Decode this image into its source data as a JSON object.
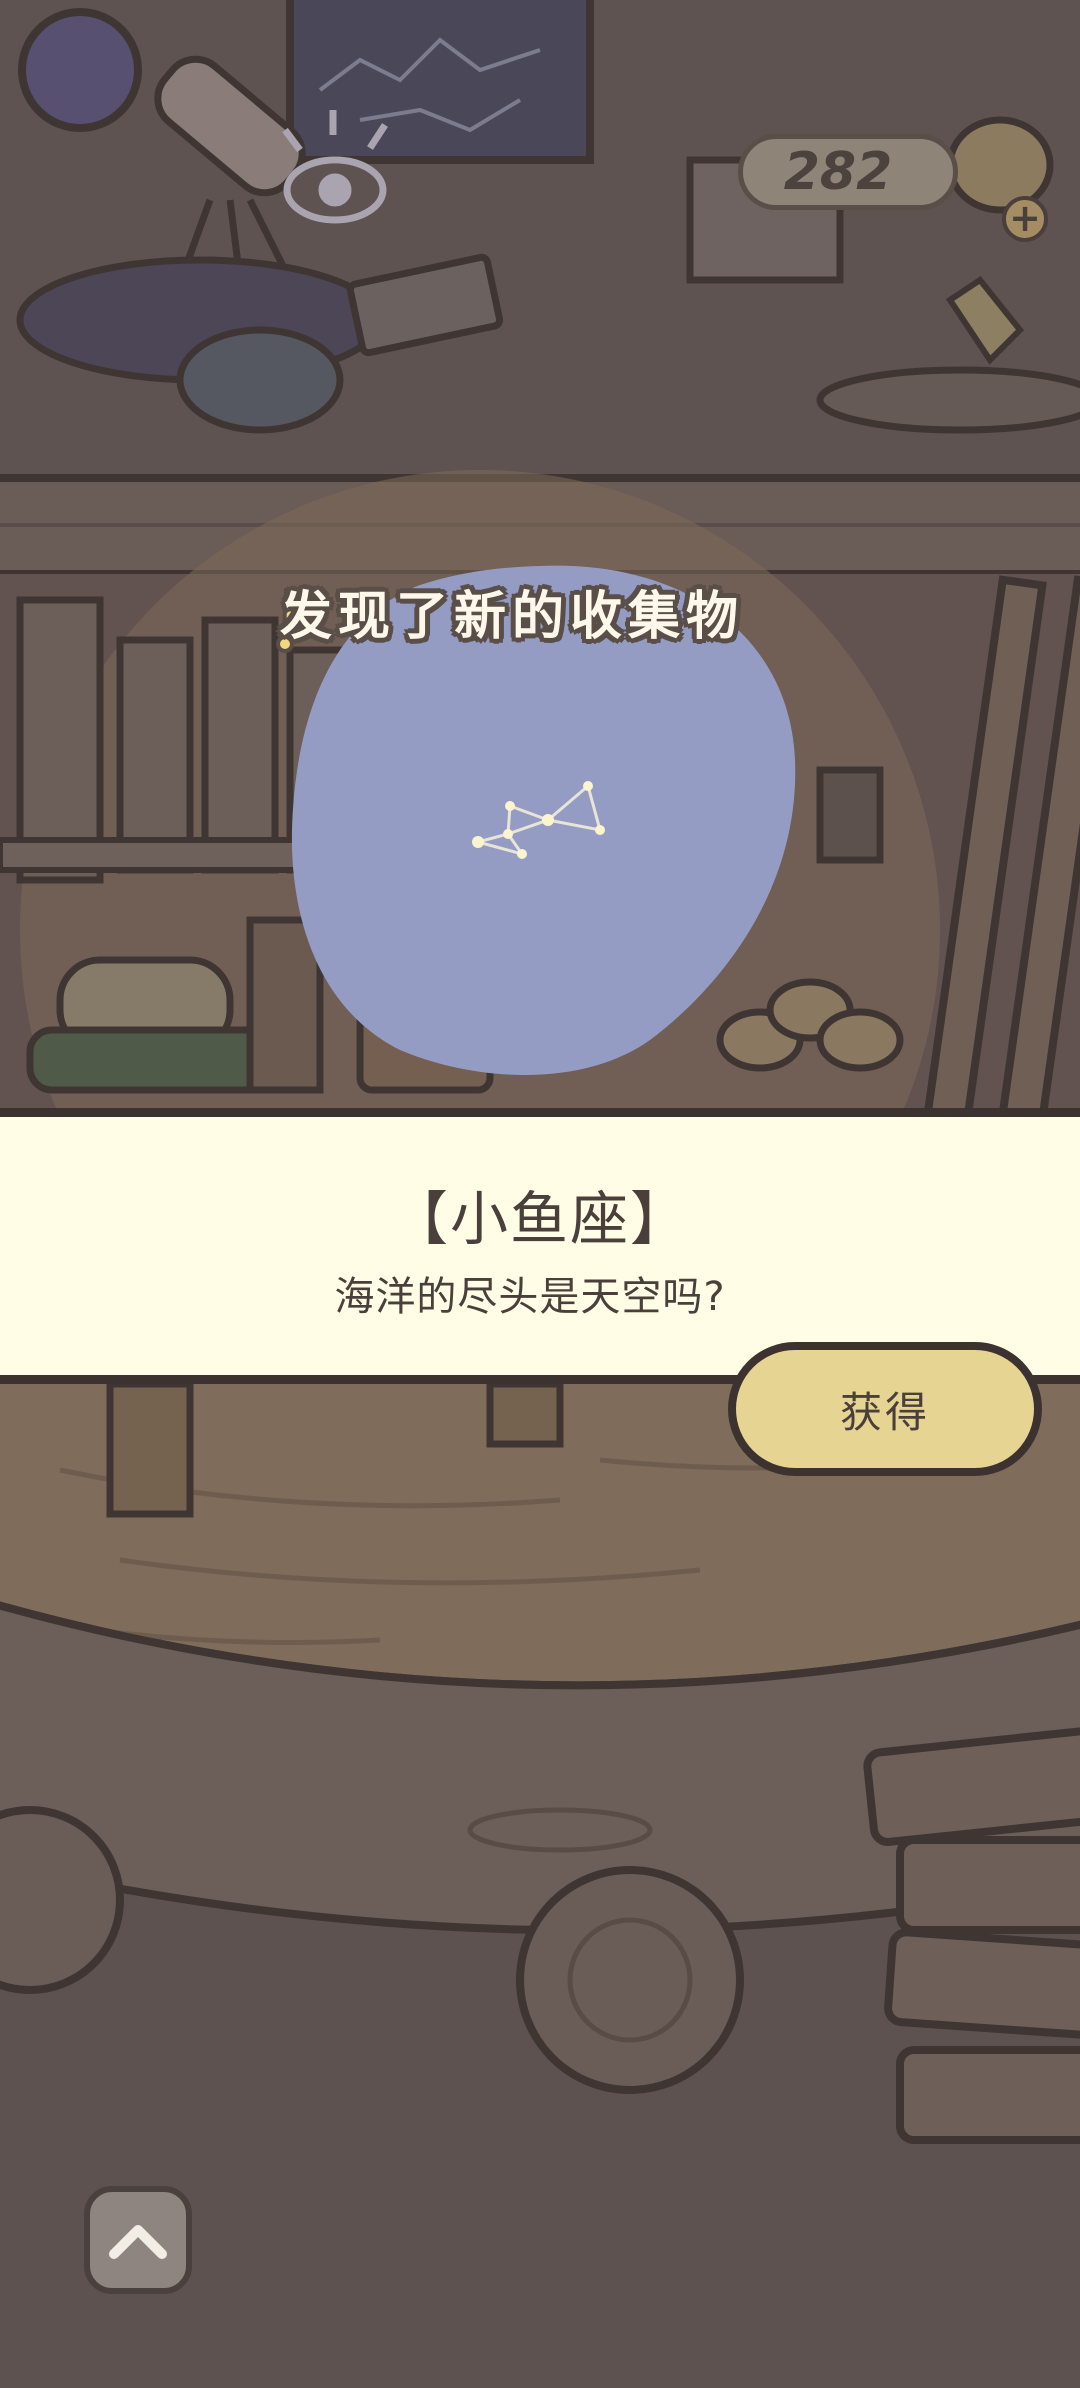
{
  "currency": {
    "value": "282",
    "add_icon": "plus-icon"
  },
  "discovery": {
    "message": "发现了新的收集物",
    "icon": "exclamation-icon"
  },
  "collectible": {
    "name": "【小鱼座】",
    "description": "海洋的尽头是天空吗?",
    "icon": "constellation-icon"
  },
  "actions": {
    "obtain_label": "获得",
    "up_icon": "chevron-up-icon"
  },
  "colors": {
    "banner_bg": "#fffde6",
    "button_bg": "#e6d492",
    "blob": "#959cc4",
    "scene_dim": "#5e5250"
  }
}
